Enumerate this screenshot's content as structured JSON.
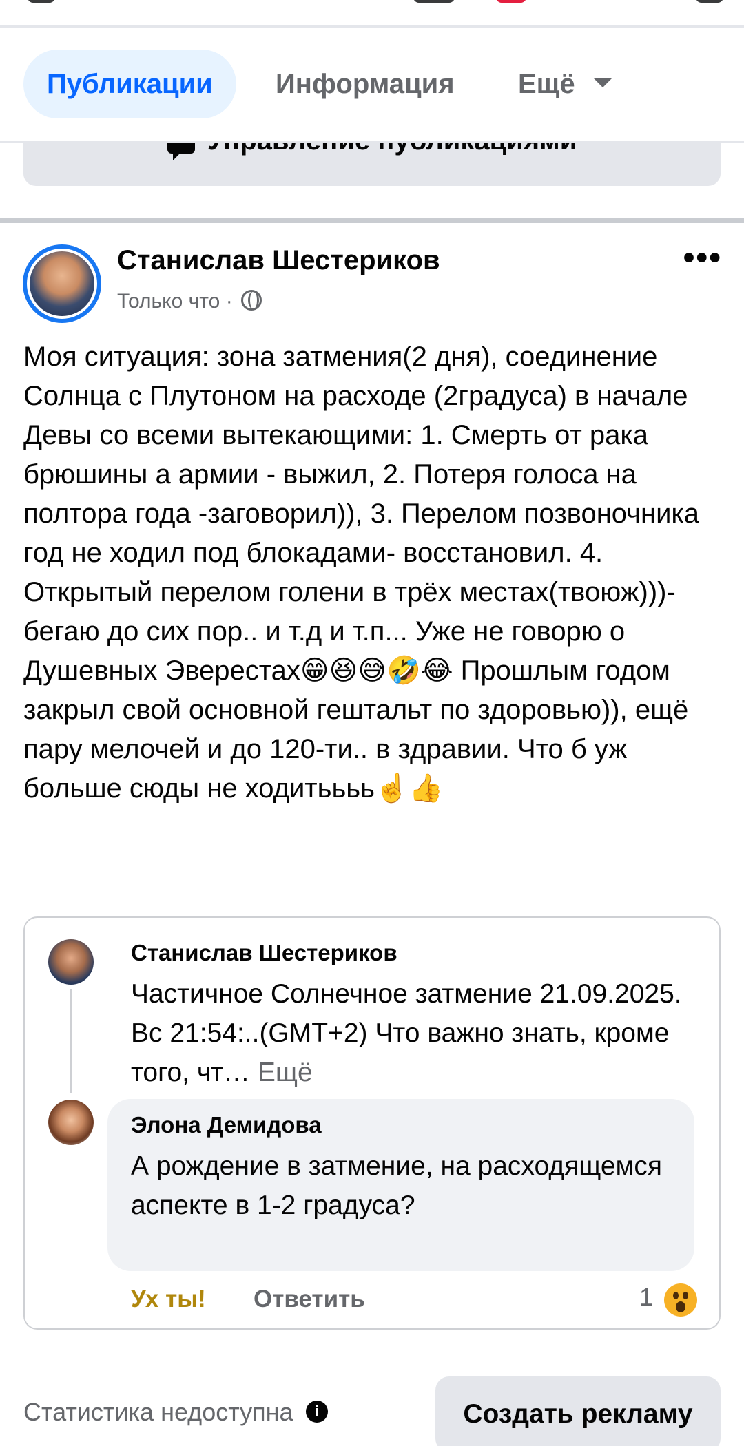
{
  "tabs": {
    "posts": "Публикации",
    "info": "Информация",
    "more": "Ещё"
  },
  "manage_posts_label": "Управление публикациями",
  "post": {
    "author": "Станислав Шестериков",
    "time": "Только что",
    "separator": "·",
    "text": "Моя ситуация: зона затмения(2 дня), соединение Солнца с Плутоном на расходе (2градуса) в начале Девы со всеми вытекающими: 1. Смерть от рака брюшины а армии - выжил, 2. Потеря голоса на полтора года -заговорил)), 3. Перелом позвоночника год не ходил под блокадами- восстановил. 4. Открытый перелом голени в трёх местах(твоюж)))-бегаю до сих пор.. и т.д и т.п... Уже не говорю о  Душевных Эверестах😁😆😅🤣😂 Прошлым годом закрыл свой основной гештальт по здоровью)), ещё пару мелочей и до 120-ти.. в здравии. Что б уж больше сюды не ходитьььь☝️👍"
  },
  "comment": {
    "author": "Станислав Шестериков",
    "text": "Частичное Солнечное затмение 21.09.2025. Вс 21:54:..(GMT+2) Что важно знать, кроме того, чт…",
    "more_link": "Ещё"
  },
  "reply": {
    "author": "Элона Демидова",
    "text": "А рождение в затмение, на расходящемся аспекте в 1-2 градуса?",
    "reaction_label": "Ух ты!",
    "reply_label": "Ответить",
    "reaction_count": "1"
  },
  "footer": {
    "stats_text": "Статистика недоступна",
    "create_ad": "Создать рекламу"
  },
  "colors": {
    "accent": "#0866ff",
    "tab_active_bg": "#e7f3ff",
    "reaction_wow": "#b0870c",
    "ring": "#1877f2"
  }
}
